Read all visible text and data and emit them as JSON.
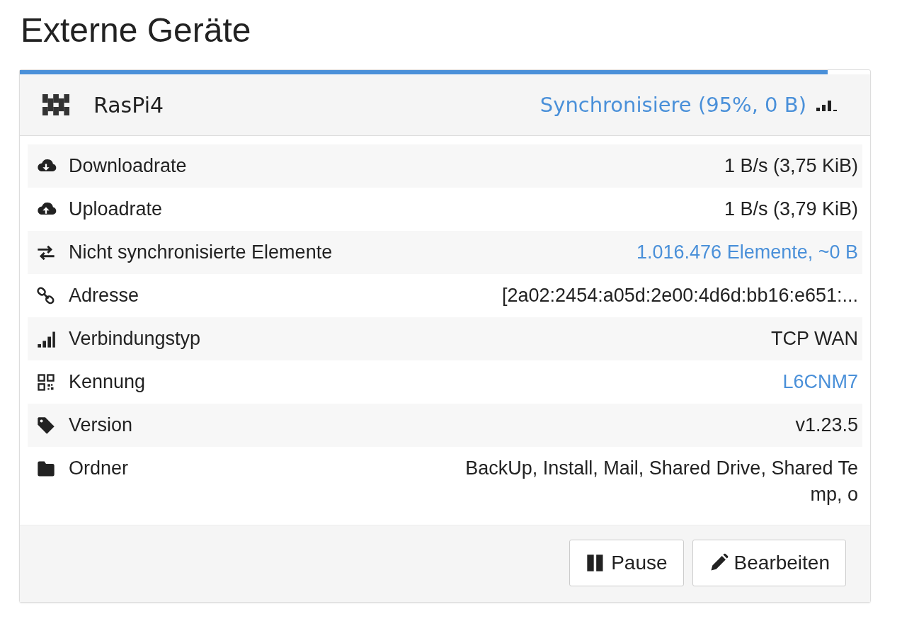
{
  "title": "Externe Geräte",
  "device": {
    "name": "RasPi4",
    "status": "Synchronisiere (95%, 0 B)",
    "level": 0.95,
    "rows": [
      {
        "kind": "download",
        "label": "Downloadrate",
        "value": "1 B/s (3,75 KiB)",
        "link": false
      },
      {
        "kind": "upload",
        "label": "Uploadrate",
        "value": "1 B/s (3,79 KiB)",
        "link": false
      },
      {
        "kind": "exchange",
        "label": "Nicht synchronisierte Elemente",
        "value": "1.016.476 Elemente, ~0 B",
        "link": true
      },
      {
        "kind": "chain",
        "label": "Adresse",
        "value": "[2a02:2454:a05d:2e00:4d6d:bb16:e651:...",
        "link": false
      },
      {
        "kind": "signal",
        "label": "Verbindungstyp",
        "value": "TCP WAN",
        "link": false
      },
      {
        "kind": "qrcode",
        "label": "Kennung",
        "value": "L6CNM7",
        "link": true
      },
      {
        "kind": "tag",
        "label": "Version",
        "value": "v1.23.5",
        "link": false
      },
      {
        "kind": "folder",
        "label": "Ordner",
        "value": "BackUp, Install, Mail, Shared Drive, Shared Temp, o",
        "link": false
      }
    ],
    "buttons": [
      {
        "kind": "pause",
        "label": "Pause"
      },
      {
        "kind": "edit",
        "label": "Bearbeiten"
      }
    ]
  }
}
